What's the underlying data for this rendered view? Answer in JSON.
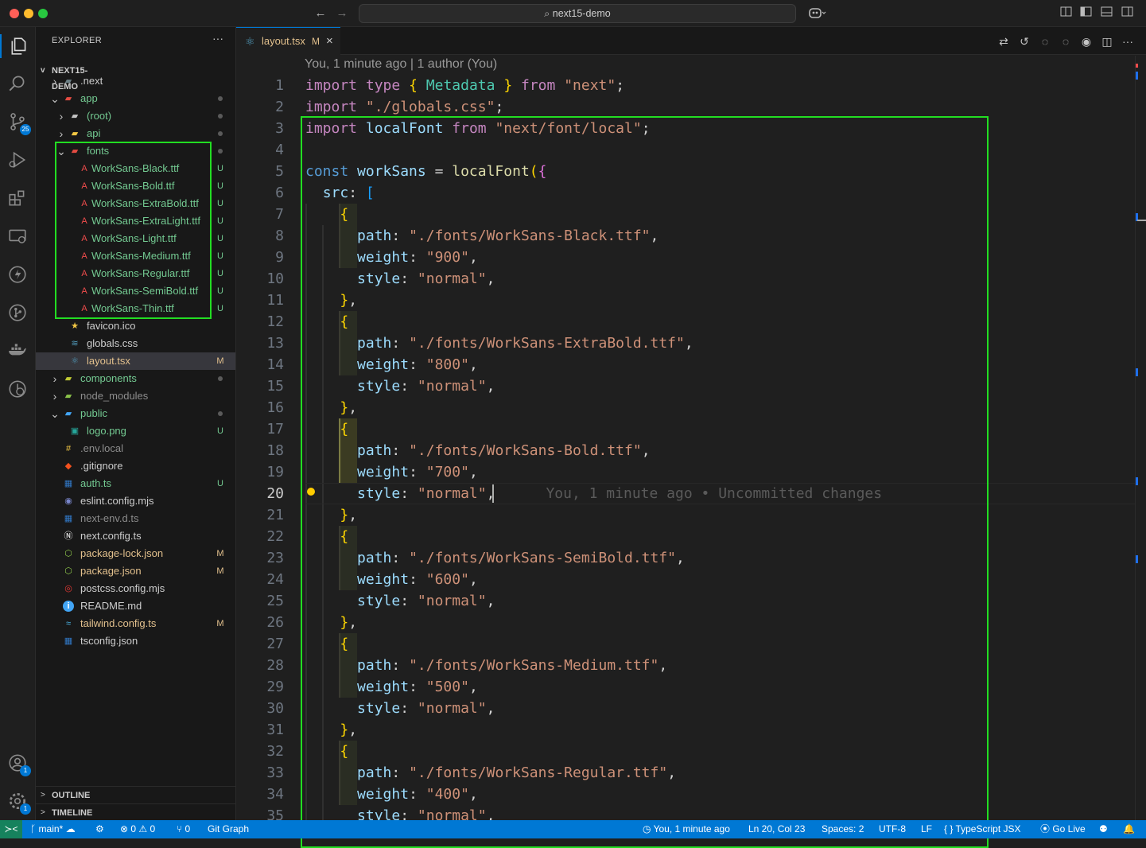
{
  "window": {
    "search_text": "next15-demo"
  },
  "explorer": {
    "title": "EXPLORER",
    "more": "···",
    "project": "NEXT15-DEMO",
    "tree": [
      {
        "label": ".next",
        "depth": 0,
        "kind": "folder",
        "chev": ">",
        "icon_color": "#6d8086",
        "text_color": "#cccccc",
        "dec": ""
      },
      {
        "label": "app",
        "depth": 0,
        "kind": "folder-open",
        "chev": "v",
        "icon_color": "#e44b42",
        "text_color": "#73c991",
        "dec": "dot"
      },
      {
        "label": "(root)",
        "depth": 1,
        "kind": "folder",
        "chev": ">",
        "icon_color": "#c5c5c5",
        "text_color": "#73c991",
        "dec": "dot"
      },
      {
        "label": "api",
        "depth": 1,
        "kind": "folder",
        "chev": ">",
        "icon_color": "#f2c744",
        "text_color": "#73c991",
        "dec": "dot"
      },
      {
        "label": "fonts",
        "depth": 1,
        "kind": "folder-open",
        "chev": "v",
        "icon_color": "#e44b42",
        "text_color": "#73c991",
        "dec": "dot"
      },
      {
        "label": "WorkSans-Black.ttf",
        "depth": 2,
        "kind": "font",
        "chev": "",
        "icon_color": "#f14c4c",
        "text_color": "#73c991",
        "dec": "U"
      },
      {
        "label": "WorkSans-Bold.ttf",
        "depth": 2,
        "kind": "font",
        "chev": "",
        "icon_color": "#f14c4c",
        "text_color": "#73c991",
        "dec": "U"
      },
      {
        "label": "WorkSans-ExtraBold.ttf",
        "depth": 2,
        "kind": "font",
        "chev": "",
        "icon_color": "#f14c4c",
        "text_color": "#73c991",
        "dec": "U"
      },
      {
        "label": "WorkSans-ExtraLight.ttf",
        "depth": 2,
        "kind": "font",
        "chev": "",
        "icon_color": "#f14c4c",
        "text_color": "#73c991",
        "dec": "U"
      },
      {
        "label": "WorkSans-Light.ttf",
        "depth": 2,
        "kind": "font",
        "chev": "",
        "icon_color": "#f14c4c",
        "text_color": "#73c991",
        "dec": "U"
      },
      {
        "label": "WorkSans-Medium.ttf",
        "depth": 2,
        "kind": "font",
        "chev": "",
        "icon_color": "#f14c4c",
        "text_color": "#73c991",
        "dec": "U"
      },
      {
        "label": "WorkSans-Regular.ttf",
        "depth": 2,
        "kind": "font",
        "chev": "",
        "icon_color": "#f14c4c",
        "text_color": "#73c991",
        "dec": "U"
      },
      {
        "label": "WorkSans-SemiBold.ttf",
        "depth": 2,
        "kind": "font",
        "chev": "",
        "icon_color": "#f14c4c",
        "text_color": "#73c991",
        "dec": "U"
      },
      {
        "label": "WorkSans-Thin.ttf",
        "depth": 2,
        "kind": "font",
        "chev": "",
        "icon_color": "#f14c4c",
        "text_color": "#73c991",
        "dec": "U"
      },
      {
        "label": "favicon.ico",
        "depth": 1,
        "kind": "star",
        "chev": "",
        "icon_color": "#f2c744",
        "text_color": "#cccccc",
        "dec": ""
      },
      {
        "label": "globals.css",
        "depth": 1,
        "kind": "css",
        "chev": "",
        "icon_color": "#519aba",
        "text_color": "#cccccc",
        "dec": ""
      },
      {
        "label": "layout.tsx",
        "depth": 1,
        "kind": "react",
        "chev": "",
        "icon_color": "#519aba",
        "text_color": "#e2c08d",
        "dec": "M",
        "selected": true
      },
      {
        "label": "components",
        "depth": 0,
        "kind": "folder",
        "chev": ">",
        "icon_color": "#c0ca33",
        "text_color": "#73c991",
        "dec": "dot"
      },
      {
        "label": "node_modules",
        "depth": 0,
        "kind": "folder",
        "chev": ">",
        "icon_color": "#8bc34a",
        "text_color": "#8c8c8c",
        "dec": ""
      },
      {
        "label": "public",
        "depth": 0,
        "kind": "folder-open",
        "chev": "v",
        "icon_color": "#42a5f5",
        "text_color": "#73c991",
        "dec": "dot"
      },
      {
        "label": "logo.png",
        "depth": 1,
        "kind": "image",
        "chev": "",
        "icon_color": "#26a69a",
        "text_color": "#73c991",
        "dec": "U"
      },
      {
        "label": ".env.local",
        "depth": 0,
        "kind": "env",
        "chev": "",
        "icon_color": "#f2c744",
        "text_color": "#8c8c8c",
        "dec": ""
      },
      {
        "label": ".gitignore",
        "depth": 0,
        "kind": "git",
        "chev": "",
        "icon_color": "#f4511e",
        "text_color": "#cccccc",
        "dec": ""
      },
      {
        "label": "auth.ts",
        "depth": 0,
        "kind": "ts",
        "chev": "",
        "icon_color": "#3178c6",
        "text_color": "#73c991",
        "dec": "U"
      },
      {
        "label": "eslint.config.mjs",
        "depth": 0,
        "kind": "eslint",
        "chev": "",
        "icon_color": "#7986cb",
        "text_color": "#cccccc",
        "dec": ""
      },
      {
        "label": "next-env.d.ts",
        "depth": 0,
        "kind": "ts",
        "chev": "",
        "icon_color": "#3178c6",
        "text_color": "#8c8c8c",
        "dec": ""
      },
      {
        "label": "next.config.ts",
        "depth": 0,
        "kind": "next",
        "chev": "",
        "icon_color": "#ffffff",
        "text_color": "#cccccc",
        "dec": ""
      },
      {
        "label": "package-lock.json",
        "depth": 0,
        "kind": "npm",
        "chev": "",
        "icon_color": "#8bc34a",
        "text_color": "#e2c08d",
        "dec": "M"
      },
      {
        "label": "package.json",
        "depth": 0,
        "kind": "npm",
        "chev": "",
        "icon_color": "#8bc34a",
        "text_color": "#e2c08d",
        "dec": "M"
      },
      {
        "label": "postcss.config.mjs",
        "depth": 0,
        "kind": "postcss",
        "chev": "",
        "icon_color": "#e53935",
        "text_color": "#cccccc",
        "dec": ""
      },
      {
        "label": "README.md",
        "depth": 0,
        "kind": "info",
        "chev": "",
        "icon_color": "#42a5f5",
        "text_color": "#cccccc",
        "dec": ""
      },
      {
        "label": "tailwind.config.ts",
        "depth": 0,
        "kind": "tailwind",
        "chev": "",
        "icon_color": "#4fc3f7",
        "text_color": "#e2c08d",
        "dec": "M"
      },
      {
        "label": "tsconfig.json",
        "depth": 0,
        "kind": "tsconfig",
        "chev": "",
        "icon_color": "#3178c6",
        "text_color": "#cccccc",
        "dec": ""
      }
    ],
    "outline": "OUTLINE",
    "timeline": "TIMELINE"
  },
  "activity": {
    "scm_badge": "25",
    "accounts_badge": "1",
    "settings_badge": "1"
  },
  "tab": {
    "name": "layout.tsx",
    "status": "M",
    "close": "×"
  },
  "blame_header": "You, 1 minute ago | 1 author (You)",
  "inline_blame": "You, 1 minute ago • Uncommitted changes",
  "code": [
    [
      [
        "kw",
        "import"
      ],
      [
        "pl",
        " "
      ],
      [
        "kw",
        "type"
      ],
      [
        "pl",
        " "
      ],
      [
        "br1",
        "{"
      ],
      [
        "pl",
        " "
      ],
      [
        "ty",
        "Metadata"
      ],
      [
        "pl",
        " "
      ],
      [
        "br1",
        "}"
      ],
      [
        "pl",
        " "
      ],
      [
        "kw",
        "from"
      ],
      [
        "pl",
        " "
      ],
      [
        "st",
        "\"next\""
      ],
      [
        "pl",
        ";"
      ]
    ],
    [
      [
        "kw",
        "import"
      ],
      [
        "pl",
        " "
      ],
      [
        "st",
        "\"./globals.css\""
      ],
      [
        "pl",
        ";"
      ]
    ],
    [
      [
        "kw",
        "import"
      ],
      [
        "pl",
        " "
      ],
      [
        "vr",
        "localFont"
      ],
      [
        "pl",
        " "
      ],
      [
        "kw",
        "from"
      ],
      [
        "pl",
        " "
      ],
      [
        "st",
        "\"next/font/local\""
      ],
      [
        "pl",
        ";"
      ]
    ],
    [],
    [
      [
        "kb",
        "const"
      ],
      [
        "pl",
        " "
      ],
      [
        "vr",
        "workSans"
      ],
      [
        "pl",
        " = "
      ],
      [
        "fn",
        "localFont"
      ],
      [
        "br1",
        "("
      ],
      [
        "br2",
        "{"
      ]
    ],
    [
      [
        "pl",
        "  "
      ],
      [
        "vr",
        "src"
      ],
      [
        "pl",
        ": "
      ],
      [
        "br3",
        "["
      ]
    ],
    [
      [
        "pl",
        "    "
      ],
      [
        "br1",
        "{"
      ]
    ],
    [
      [
        "pl",
        "      "
      ],
      [
        "vr",
        "path"
      ],
      [
        "pl",
        ": "
      ],
      [
        "st",
        "\"./fonts/WorkSans-Black.ttf\""
      ],
      [
        "pl",
        ","
      ]
    ],
    [
      [
        "pl",
        "      "
      ],
      [
        "vr",
        "weight"
      ],
      [
        "pl",
        ": "
      ],
      [
        "st",
        "\"900\""
      ],
      [
        "pl",
        ","
      ]
    ],
    [
      [
        "pl",
        "      "
      ],
      [
        "vr",
        "style"
      ],
      [
        "pl",
        ": "
      ],
      [
        "st",
        "\"normal\""
      ],
      [
        "pl",
        ","
      ]
    ],
    [
      [
        "pl",
        "    "
      ],
      [
        "br1",
        "}"
      ],
      [
        "pl",
        ","
      ]
    ],
    [
      [
        "pl",
        "    "
      ],
      [
        "br1",
        "{"
      ]
    ],
    [
      [
        "pl",
        "      "
      ],
      [
        "vr",
        "path"
      ],
      [
        "pl",
        ": "
      ],
      [
        "st",
        "\"./fonts/WorkSans-ExtraBold.ttf\""
      ],
      [
        "pl",
        ","
      ]
    ],
    [
      [
        "pl",
        "      "
      ],
      [
        "vr",
        "weight"
      ],
      [
        "pl",
        ": "
      ],
      [
        "st",
        "\"800\""
      ],
      [
        "pl",
        ","
      ]
    ],
    [
      [
        "pl",
        "      "
      ],
      [
        "vr",
        "style"
      ],
      [
        "pl",
        ": "
      ],
      [
        "st",
        "\"normal\""
      ],
      [
        "pl",
        ","
      ]
    ],
    [
      [
        "pl",
        "    "
      ],
      [
        "br1",
        "}"
      ],
      [
        "pl",
        ","
      ]
    ],
    [
      [
        "pl",
        "    "
      ],
      [
        "br1",
        "{"
      ]
    ],
    [
      [
        "pl",
        "      "
      ],
      [
        "vr",
        "path"
      ],
      [
        "pl",
        ": "
      ],
      [
        "st",
        "\"./fonts/WorkSans-Bold.ttf\""
      ],
      [
        "pl",
        ","
      ]
    ],
    [
      [
        "pl",
        "      "
      ],
      [
        "vr",
        "weight"
      ],
      [
        "pl",
        ": "
      ],
      [
        "st",
        "\"700\""
      ],
      [
        "pl",
        ","
      ]
    ],
    [
      [
        "pl",
        "      "
      ],
      [
        "vr",
        "style"
      ],
      [
        "pl",
        ": "
      ],
      [
        "st",
        "\"normal\""
      ],
      [
        "pl",
        ","
      ]
    ],
    [
      [
        "pl",
        "    "
      ],
      [
        "br1",
        "}"
      ],
      [
        "pl",
        ","
      ]
    ],
    [
      [
        "pl",
        "    "
      ],
      [
        "br1",
        "{"
      ]
    ],
    [
      [
        "pl",
        "      "
      ],
      [
        "vr",
        "path"
      ],
      [
        "pl",
        ": "
      ],
      [
        "st",
        "\"./fonts/WorkSans-SemiBold.ttf\""
      ],
      [
        "pl",
        ","
      ]
    ],
    [
      [
        "pl",
        "      "
      ],
      [
        "vr",
        "weight"
      ],
      [
        "pl",
        ": "
      ],
      [
        "st",
        "\"600\""
      ],
      [
        "pl",
        ","
      ]
    ],
    [
      [
        "pl",
        "      "
      ],
      [
        "vr",
        "style"
      ],
      [
        "pl",
        ": "
      ],
      [
        "st",
        "\"normal\""
      ],
      [
        "pl",
        ","
      ]
    ],
    [
      [
        "pl",
        "    "
      ],
      [
        "br1",
        "}"
      ],
      [
        "pl",
        ","
      ]
    ],
    [
      [
        "pl",
        "    "
      ],
      [
        "br1",
        "{"
      ]
    ],
    [
      [
        "pl",
        "      "
      ],
      [
        "vr",
        "path"
      ],
      [
        "pl",
        ": "
      ],
      [
        "st",
        "\"./fonts/WorkSans-Medium.ttf\""
      ],
      [
        "pl",
        ","
      ]
    ],
    [
      [
        "pl",
        "      "
      ],
      [
        "vr",
        "weight"
      ],
      [
        "pl",
        ": "
      ],
      [
        "st",
        "\"500\""
      ],
      [
        "pl",
        ","
      ]
    ],
    [
      [
        "pl",
        "      "
      ],
      [
        "vr",
        "style"
      ],
      [
        "pl",
        ": "
      ],
      [
        "st",
        "\"normal\""
      ],
      [
        "pl",
        ","
      ]
    ],
    [
      [
        "pl",
        "    "
      ],
      [
        "br1",
        "}"
      ],
      [
        "pl",
        ","
      ]
    ],
    [
      [
        "pl",
        "    "
      ],
      [
        "br1",
        "{"
      ]
    ],
    [
      [
        "pl",
        "      "
      ],
      [
        "vr",
        "path"
      ],
      [
        "pl",
        ": "
      ],
      [
        "st",
        "\"./fonts/WorkSans-Regular.ttf\""
      ],
      [
        "pl",
        ","
      ]
    ],
    [
      [
        "pl",
        "      "
      ],
      [
        "vr",
        "weight"
      ],
      [
        "pl",
        ": "
      ],
      [
        "st",
        "\"400\""
      ],
      [
        "pl",
        ","
      ]
    ],
    [
      [
        "pl",
        "      "
      ],
      [
        "vr",
        "style"
      ],
      [
        "pl",
        ": "
      ],
      [
        "st",
        "\"normal\""
      ],
      [
        "pl",
        ","
      ]
    ]
  ],
  "current_line": 20,
  "statusbar": {
    "branch": "main*",
    "errors": "0",
    "warnings": "0",
    "ports": "0",
    "git_graph": "Git Graph",
    "blame": "You, 1 minute ago",
    "position": "Ln 20, Col 23",
    "spaces": "Spaces: 2",
    "encoding": "UTF-8",
    "eol": "LF",
    "language": "TypeScript JSX",
    "golive": "Go Live"
  }
}
